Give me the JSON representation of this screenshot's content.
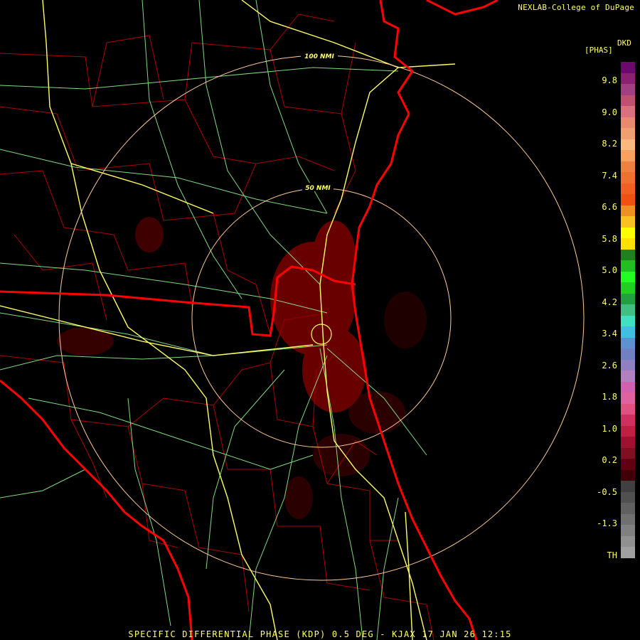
{
  "credit": "NEXLAB-College of DuPage",
  "legend": {
    "product": "DKD",
    "unit": "[PHAS]",
    "ticks": [
      "9.8",
      "9.0",
      "8.2",
      "7.4",
      "6.6",
      "5.8",
      "5.0",
      "4.2",
      "3.4",
      "2.6",
      "1.8",
      "1.0",
      "0.2",
      "-0.5",
      "-1.3",
      "TH"
    ],
    "colors": [
      "#6a0a6a",
      "#8a2070",
      "#a04080",
      "#c05070",
      "#d87080",
      "#e88a70",
      "#f0a070",
      "#f8b880",
      "#f8a060",
      "#f08040",
      "#f07030",
      "#f06020",
      "#f05010",
      "#f09020",
      "#f8c020",
      "#ffff00",
      "#ffe000",
      "#208020",
      "#20c020",
      "#20ff20",
      "#20d020",
      "#20a040",
      "#40c080",
      "#40e0c0",
      "#40c0e0",
      "#6090d0",
      "#7080c0",
      "#9080c0",
      "#b080c0",
      "#d060b0",
      "#e060a0",
      "#e05080",
      "#d03060",
      "#c02040",
      "#a01030",
      "#801020",
      "#600010",
      "#400008",
      "#404040",
      "#505050",
      "#606060",
      "#707070",
      "#808080",
      "#909090",
      "#a0a0a0",
      "#000000"
    ]
  },
  "rings": [
    {
      "label": "50 NMI",
      "color": "#ffcc99"
    },
    {
      "label": "100 NMI",
      "color": "#ffcc99"
    }
  ],
  "map_colors": {
    "state_borders": "#ff0000",
    "county_lines": "#c00000",
    "highways": "#ffff66",
    "roads": "#99ff99",
    "echo": "#8b0000"
  },
  "footer": "SPECIFIC DIFFERENTIAL PHASE (KDP) 0.5 DEG - KJAX 17 JAN 26 12:15"
}
